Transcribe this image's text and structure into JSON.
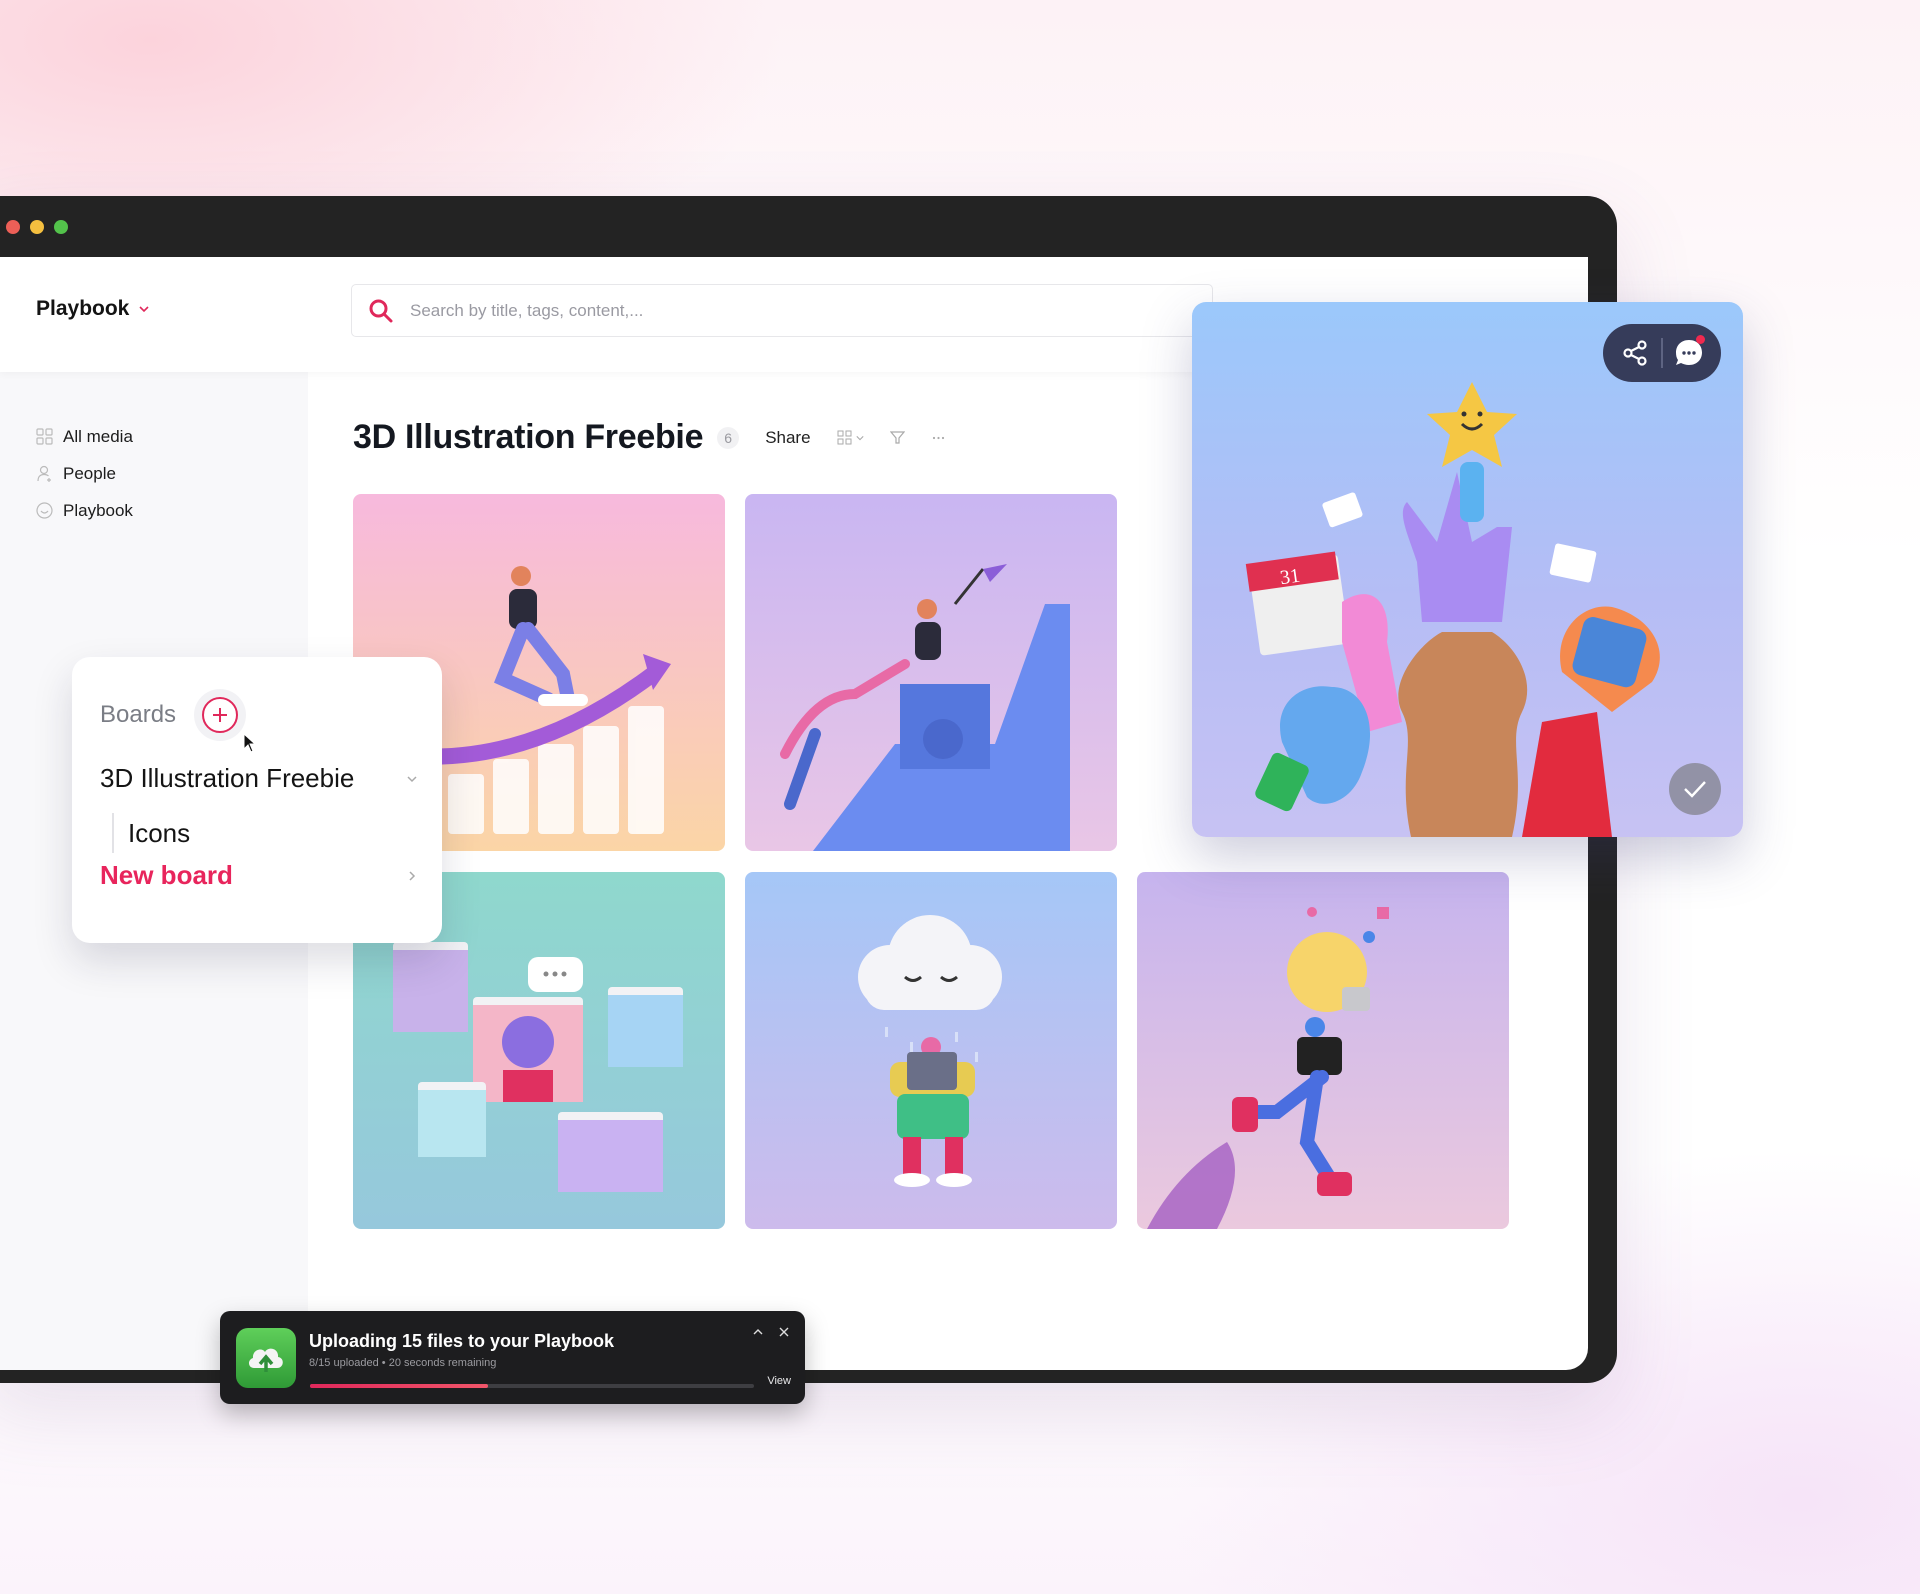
{
  "window": {
    "controls": [
      "close",
      "minimize",
      "maximize"
    ]
  },
  "header": {
    "workspace": "Playbook",
    "search": {
      "placeholder": "Search by title, tags, content,...",
      "value": ""
    }
  },
  "sidebar": {
    "items": [
      {
        "label": "All media",
        "icon": "grid-icon"
      },
      {
        "label": "People",
        "icon": "person-icon"
      },
      {
        "label": "Playbook",
        "icon": "smile-icon"
      }
    ]
  },
  "main": {
    "title": "3D Illustration Freebie",
    "count": "6",
    "share_label": "Share",
    "toolbar_icons": [
      "grid-view-icon",
      "filter-icon",
      "more-icon"
    ],
    "cards": [
      {
        "name": "person-rollerskating-growth-chart",
        "bg": [
          "#f7b9dd",
          "#fbd5a6"
        ]
      },
      {
        "name": "people-climbing-stairs-flag",
        "bg": [
          "#c9b6f2",
          "#e9c6e6"
        ]
      },
      {
        "name": "video-call-grid",
        "bg": [
          "#8fd8cd",
          "#96c8dc"
        ]
      },
      {
        "name": "rain-cloud-character",
        "bg": [
          "#a5c7f7",
          "#cdbbec"
        ]
      },
      {
        "name": "person-lightbulb-rocket",
        "bg": [
          "#c6b4ee",
          "#ebc9de"
        ]
      }
    ]
  },
  "preview": {
    "name": "hands-holding-icons",
    "calendar_day": "31",
    "share_icon": "share-icon",
    "comment_icon": "comment-icon",
    "has_notification": true,
    "selected": true
  },
  "boards_popup": {
    "title": "Boards",
    "boards": [
      {
        "label": "3D Illustration Freebie",
        "expanded": true,
        "children": [
          {
            "label": "Icons"
          }
        ]
      }
    ],
    "new_board_label": "New board"
  },
  "upload_toast": {
    "title": "Uploading 15 files to your Playbook",
    "subtitle": "8/15 uploaded • 20 seconds remaining",
    "uploaded": 8,
    "total": 15,
    "progress_fraction": 0.4,
    "view_label": "View"
  },
  "colors": {
    "accent": "#e8255c",
    "frame": "#232323",
    "toast_bg": "#1d1d1f",
    "upload_green": "#3fae3f"
  }
}
